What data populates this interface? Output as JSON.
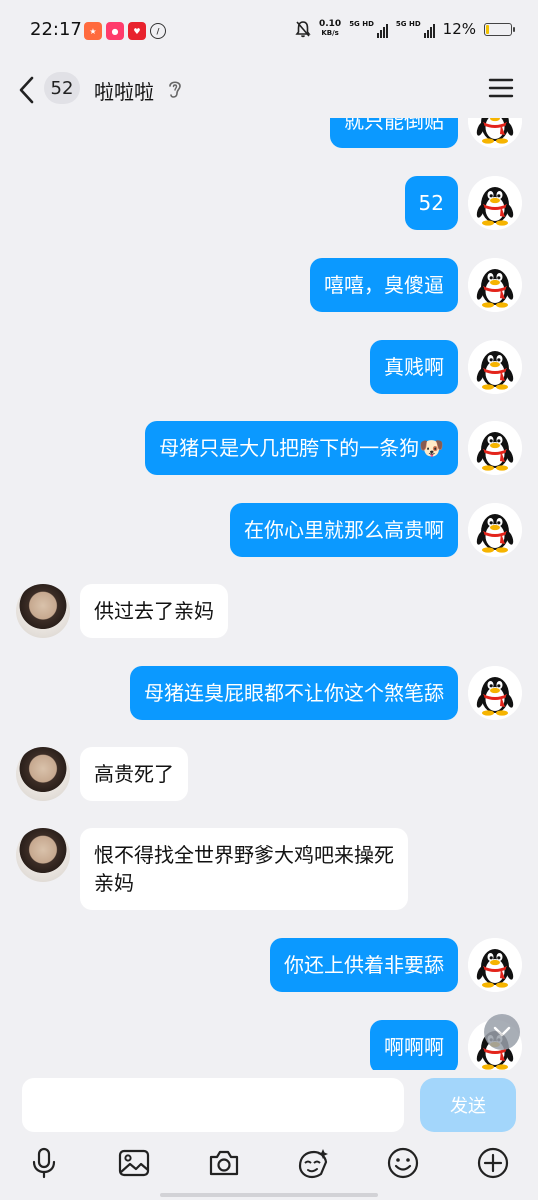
{
  "status_bar": {
    "time": "22:17",
    "net_speed_value": "0.10",
    "net_speed_unit": "KB/s",
    "signal1_label": "5G HD",
    "signal2_label": "5G HD",
    "battery_percent": "12%",
    "battery_level": 0.12
  },
  "header": {
    "unread_count": "52",
    "title": "啦啦啦"
  },
  "messages": [
    {
      "side": "out",
      "text": "就只能倒贴"
    },
    {
      "side": "out",
      "text": "52"
    },
    {
      "side": "out",
      "text": "嘻嘻，臭傻逼"
    },
    {
      "side": "out",
      "text": "真贱啊"
    },
    {
      "side": "out",
      "text": "母猪只是大几把胯下的一条狗🐶"
    },
    {
      "side": "out",
      "text": "在你心里就那么高贵啊"
    },
    {
      "side": "in",
      "text": "供过去了亲妈"
    },
    {
      "side": "out",
      "text": "母猪连臭屁眼都不让你这个煞笔舔"
    },
    {
      "side": "in",
      "text": "高贵死了"
    },
    {
      "side": "in",
      "text": "恨不得找全世界野爹大鸡吧来操死\n亲妈"
    },
    {
      "side": "out",
      "text": "你还上供着非要舔"
    },
    {
      "side": "out",
      "text": "啊啊啊"
    }
  ],
  "input": {
    "value": "",
    "send_label": "发送"
  },
  "toolbar": {
    "icons": [
      "microphone-icon",
      "image-icon",
      "camera-icon",
      "sticker-icon",
      "emoji-icon",
      "plus-icon"
    ]
  },
  "colors": {
    "outgoing_bubble": "#0b99ff",
    "incoming_bubble": "#ffffff",
    "background": "#f0f0f3",
    "send_button_disabled": "#a3d6fb"
  }
}
